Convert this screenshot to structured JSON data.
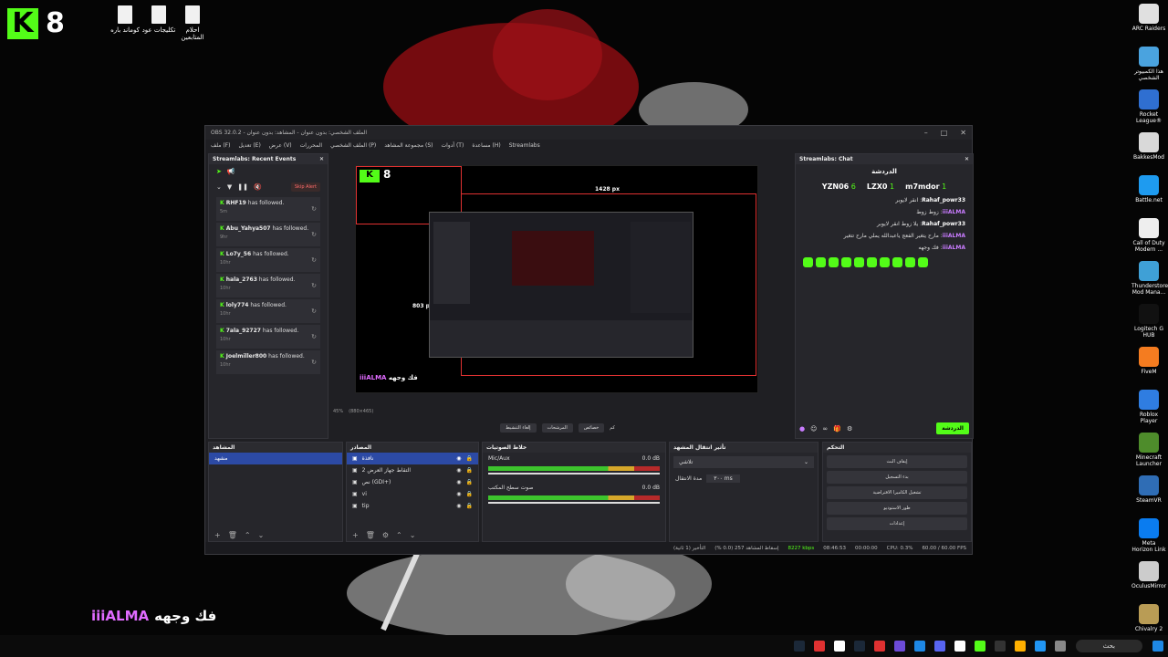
{
  "desktop": {
    "logo_number": "8",
    "files": [
      {
        "label": "كوماند باره"
      },
      {
        "label": "تكليجات عود"
      },
      {
        "label": "احلام المتابعين"
      }
    ],
    "right_icons": [
      {
        "label": "ARC Raiders",
        "color": "#e0e0e0"
      },
      {
        "label": "هذا الكمبيوتر الشخصي",
        "color": "#4aa3df"
      },
      {
        "label": "Rocket League®",
        "color": "#2f6fd1"
      },
      {
        "label": "BakkesMod",
        "color": "#d9d9d9"
      },
      {
        "label": "Battle.net",
        "color": "#1e9bf0"
      },
      {
        "label": "Call of Duty Modern ...",
        "color": "#eeeeee"
      },
      {
        "label": "Thunderstore Mod Mana...",
        "color": "#3fa0d6"
      },
      {
        "label": "Logitech G HUB",
        "color": "#111111"
      },
      {
        "label": "FiveM",
        "color": "#f47c20"
      },
      {
        "label": "Roblox Player",
        "color": "#2f7de1"
      },
      {
        "label": "Minecraft Launcher",
        "color": "#4e8c2b"
      },
      {
        "label": "SteamVR",
        "color": "#2f6db5"
      },
      {
        "label": "Meta Horizon Link",
        "color": "#0a7cf0"
      },
      {
        "label": "OculusMirror",
        "color": "#cccccc"
      },
      {
        "label": "Chivalry 2",
        "color": "#b99c55"
      }
    ]
  },
  "obs": {
    "title": "OBS 32.0.2 - الملف الشخصي: بدون عنوان - المشاهد: بدون عنوان",
    "menu": [
      "ملف (F)",
      "تعديل (E)",
      "عرض (V)",
      "المحررات",
      "الملف الشخصي (P)",
      "مجموعة المشاهد (S)",
      "أدوات (T)",
      "مساعدة (H)",
      "Streamlabs"
    ],
    "events_dock": {
      "title": "Streamlabs: Recent Events",
      "skip_label": "Skip Alert",
      "items": [
        {
          "name": "RHF19",
          "action": "has followed.",
          "time": "5m"
        },
        {
          "name": "Abu_Yahya507",
          "action": "has followed.",
          "time": "9hr"
        },
        {
          "name": "Lo7y_56",
          "action": "has followed.",
          "time": "10hr"
        },
        {
          "name": "hala_2763",
          "action": "has followed.",
          "time": "10hr"
        },
        {
          "name": "loly774",
          "action": "has followed.",
          "time": "10hr"
        },
        {
          "name": "7ala_92727",
          "action": "has followed.",
          "time": "10hr"
        },
        {
          "name": "Joelmiller800",
          "action": "has followed.",
          "time": "10hr"
        }
      ]
    },
    "preview": {
      "width_label": "1428 px",
      "height_label": "803 px",
      "zoom": "45%",
      "resolution": "(880×465)"
    },
    "preview_buttons": [
      "إلغاء التنشيط",
      "المرشحات",
      "خصائص",
      "كم"
    ],
    "chat_dock": {
      "title": "Streamlabs: Chat",
      "header": "الدردشة",
      "top_users": [
        {
          "name": "YZN06",
          "count": "6"
        },
        {
          "name": "LZX0",
          "count": "1"
        },
        {
          "name": "m7mdor",
          "count": "1"
        }
      ],
      "messages": [
        {
          "user": "Rahaf_powr33",
          "text": "انقر لايوبر"
        },
        {
          "user": "iiiALMA",
          "text": "زوط زوط"
        },
        {
          "user": "Rahaf_powr33",
          "text": "يلا زوط انقر لايوبر"
        },
        {
          "user": "iiiALMA",
          "text": "مارح يتغير الفعج ياعبدالله يملي مارح تتغير"
        },
        {
          "user": "iiiALMA",
          "text": "فك وجهه"
        }
      ],
      "send_label": "الدردشة"
    },
    "scenes": {
      "title": "المشاهد",
      "items": [
        "مشهد"
      ]
    },
    "sources": {
      "title": "المصادر",
      "items": [
        "نافذة",
        "التقاط جهاز العرض 2",
        "نص (GDI+)",
        "vi",
        "tip"
      ]
    },
    "mixer": {
      "title": "خلاط الصوتيات",
      "channels": [
        {
          "name": "Mic/Aux",
          "db": "0.0 dB"
        },
        {
          "name": "صوت سطح المكتب",
          "db": "0.0 dB"
        }
      ],
      "scale": [
        "-60",
        "-55",
        "-50",
        "-45",
        "-40",
        "-35",
        "-30",
        "-25",
        "-20",
        "-15",
        "-10",
        "-5",
        "0"
      ]
    },
    "transitions": {
      "title": "تأثير انتقال المشهد",
      "selected": "تلاشي",
      "duration_label": "مدة الانتقال",
      "duration": "٣٠٠ ms"
    },
    "controls": {
      "title": "التحكم",
      "buttons": [
        "إيقاف البث",
        "بدء التسجيل",
        "تشغيل الكاميرا الافتراضية",
        "طور الاستوديو",
        "إعدادات"
      ]
    },
    "status": {
      "dropped": "إسقاط المشاهد 257 (0.0 %)",
      "delay": "التأخير (1 ثانية)",
      "bitrate": "8227 kbps",
      "time": "08:46:53",
      "rec": "00:00:00",
      "cpu": "CPU: 0.3%",
      "fps": "60.00 / 60.00 FPS"
    }
  },
  "overlay": {
    "user": "iiiALMA",
    "message": "فك وجهه"
  },
  "taskbar": {
    "search": "بحث"
  }
}
